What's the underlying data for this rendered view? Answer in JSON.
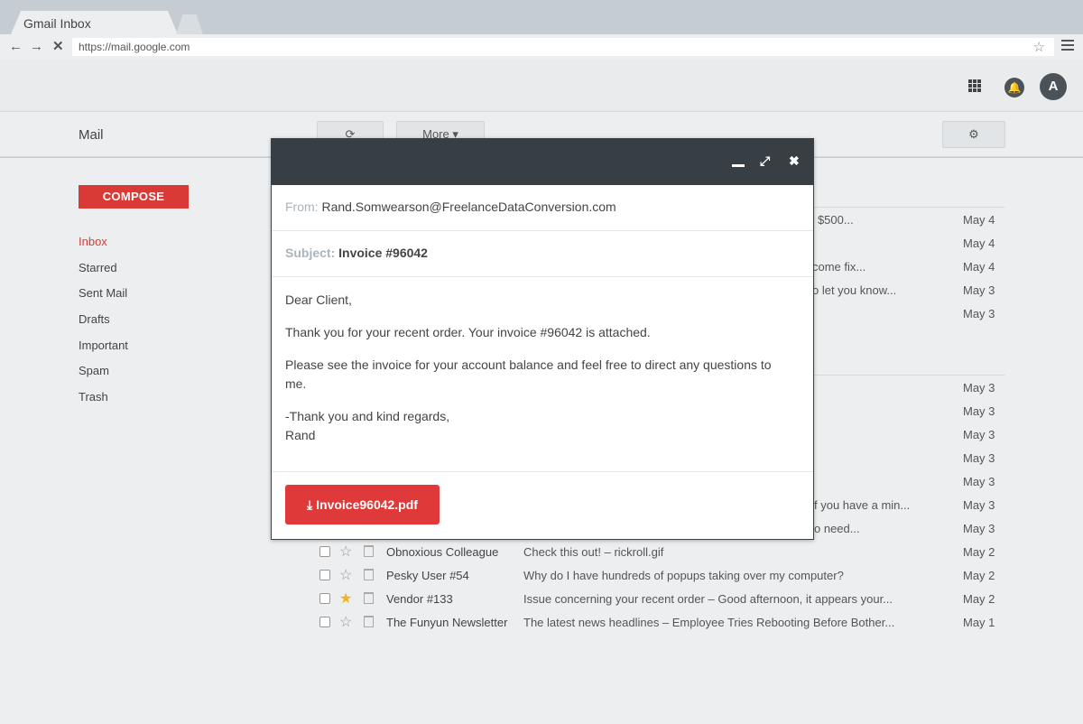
{
  "browser": {
    "tab_title": "Gmail Inbox",
    "url": "https://mail.google.com"
  },
  "app": {
    "title": "Mail",
    "avatar_letter": "A",
    "more_label": "More ▾",
    "compose_label": "COMPOSE"
  },
  "sidebar": {
    "items": [
      {
        "label": "Inbox",
        "active": true
      },
      {
        "label": "Starred"
      },
      {
        "label": "Sent Mail"
      },
      {
        "label": "Drafts"
      },
      {
        "label": "Important"
      },
      {
        "label": "Spam"
      },
      {
        "label": "Trash"
      }
    ]
  },
  "partial_rows": [
    {
      "snippet": "r $500...",
      "date": "May 4"
    },
    {
      "snippet": "",
      "date": "May 4"
    },
    {
      "snippet": "come fix...",
      "date": "May 4"
    },
    {
      "snippet": "o let you know...",
      "date": "May 3"
    },
    {
      "snippet": "",
      "date": "May 3"
    },
    {
      "snippet": "",
      "date": "May 3"
    },
    {
      "snippet": "",
      "date": "May 3"
    },
    {
      "snippet": "",
      "date": "May 3"
    },
    {
      "snippet": "",
      "date": "May 3"
    },
    {
      "snippet": "",
      "date": "May 3"
    },
    {
      "snippet": "f you have a min...",
      "date": "May 3"
    },
    {
      "snippet": "o need...",
      "date": "May 3"
    }
  ],
  "emails": [
    {
      "sender": "Obnoxious Colleague",
      "subject": "Check this out! – rickroll.gif",
      "date": "May 2",
      "starred": false
    },
    {
      "sender": "Pesky User #54",
      "subject": "Why do I have hundreds of popups taking over my computer?",
      "date": "May 2",
      "starred": false
    },
    {
      "sender": "Vendor #133",
      "subject": "Issue concerning your recent order – Good afternoon, it appears your...",
      "date": "May 2",
      "starred": true
    },
    {
      "sender": "The Funyun Newsletter",
      "subject": "The latest news headlines – Employee Tries Rebooting Before Bother...",
      "date": "May 1",
      "starred": false
    }
  ],
  "message": {
    "from_label": "From:",
    "from_value": "Rand.Somwearson@FreelanceDataConversion.com",
    "subject_label": "Subject:",
    "subject_value": "Invoice #96042",
    "greeting": "Dear Client,",
    "para1": "Thank you for your recent order. Your invoice #96042 is attached.",
    "para2": "Please see the invoice for your account balance and feel free to direct any questions to me.",
    "closing": "-Thank you and kind regards,",
    "signature": "Rand",
    "attachment": "Invoice96042.pdf"
  },
  "colors": {
    "accent_red": "#d93a36",
    "modal_header": "#373f45",
    "star_on": "#f2b31d"
  }
}
